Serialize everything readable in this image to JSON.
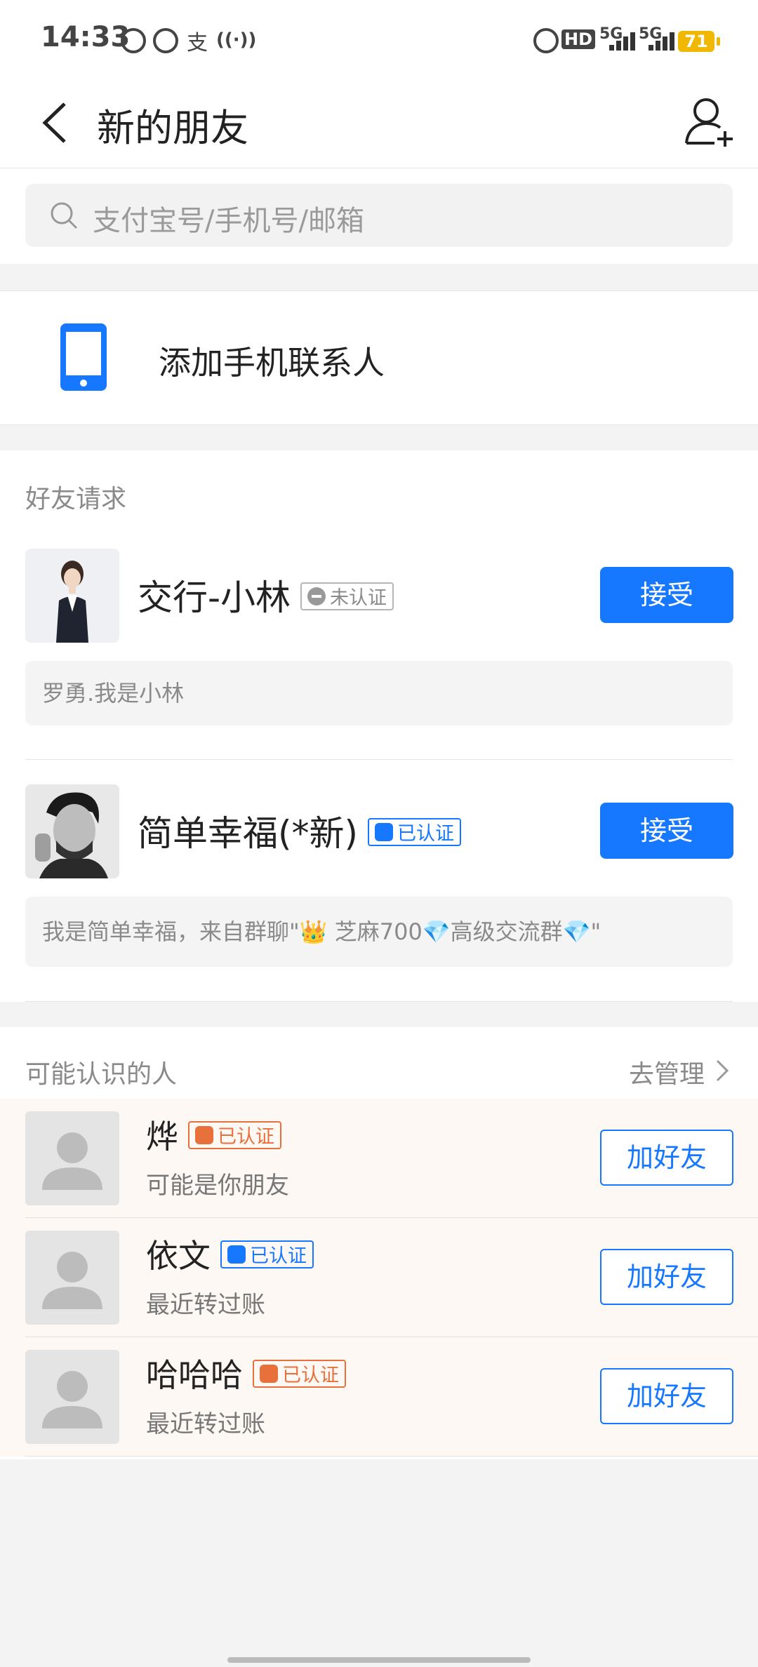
{
  "status_bar": {
    "time": "14:33",
    "network1": "5G",
    "network2": "5G",
    "battery": "71"
  },
  "nav": {
    "title": "新的朋友"
  },
  "search": {
    "placeholder": "支付宝号/手机号/邮箱"
  },
  "add_contacts": {
    "label": "添加手机联系人"
  },
  "friend_requests": {
    "title": "好友请求",
    "items": [
      {
        "name": "交行-小林",
        "badge": "未认证",
        "accept": "接受",
        "message": "罗勇.我是小林"
      },
      {
        "name": "简单幸福(*新)",
        "badge": "已认证",
        "accept": "接受",
        "message": "我是简单幸福，来自群聊\"👑  芝麻700💎高级交流群💎\""
      }
    ]
  },
  "people_you_may_know": {
    "title": "可能认识的人",
    "manage": "去管理",
    "items": [
      {
        "name": "烨",
        "badge": "已认证",
        "subtitle": "可能是你朋友",
        "action": "加好友"
      },
      {
        "name": "依文",
        "badge": "已认证",
        "subtitle": "最近转过账",
        "action": "加好友"
      },
      {
        "name": "哈哈哈",
        "badge": "已认证",
        "subtitle": "最近转过账",
        "action": "加好友"
      }
    ]
  },
  "colors": {
    "accent": "#1677ff",
    "verified_orange": "#e8703a"
  }
}
